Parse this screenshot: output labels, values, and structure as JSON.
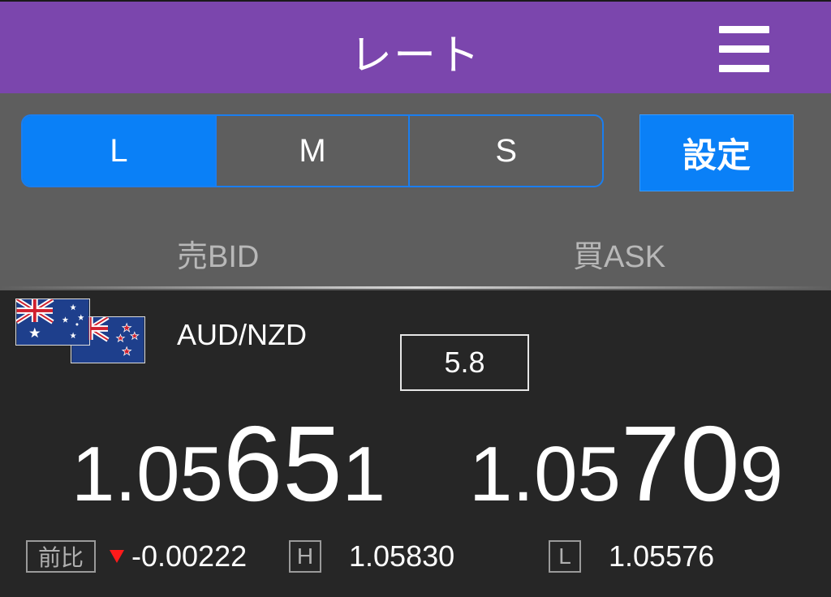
{
  "header": {
    "title": "レート",
    "menu_icon": "hamburger-menu-icon"
  },
  "size_selector": {
    "options": [
      "L",
      "M",
      "S"
    ],
    "selected": "L"
  },
  "settings_button": {
    "label": "設定"
  },
  "columns": {
    "bid": "売BID",
    "ask": "買ASK"
  },
  "rate": {
    "pair": "AUD/NZD",
    "flags": [
      "australia-flag-icon",
      "new-zealand-flag-icon"
    ],
    "spread": "5.8",
    "bid": {
      "prefix": "1.05",
      "pips": "65",
      "suffix": "1"
    },
    "ask": {
      "prefix": "1.05",
      "pips": "70",
      "suffix": "9"
    },
    "change_label": "前比",
    "change_value": "-0.00222",
    "high_label": "H",
    "high_value": "1.05830",
    "low_label": "L",
    "low_value": "1.05576"
  },
  "colors": {
    "header": "#7b46ad",
    "accent": "#0a80f7",
    "down": "#ff1a1a"
  }
}
